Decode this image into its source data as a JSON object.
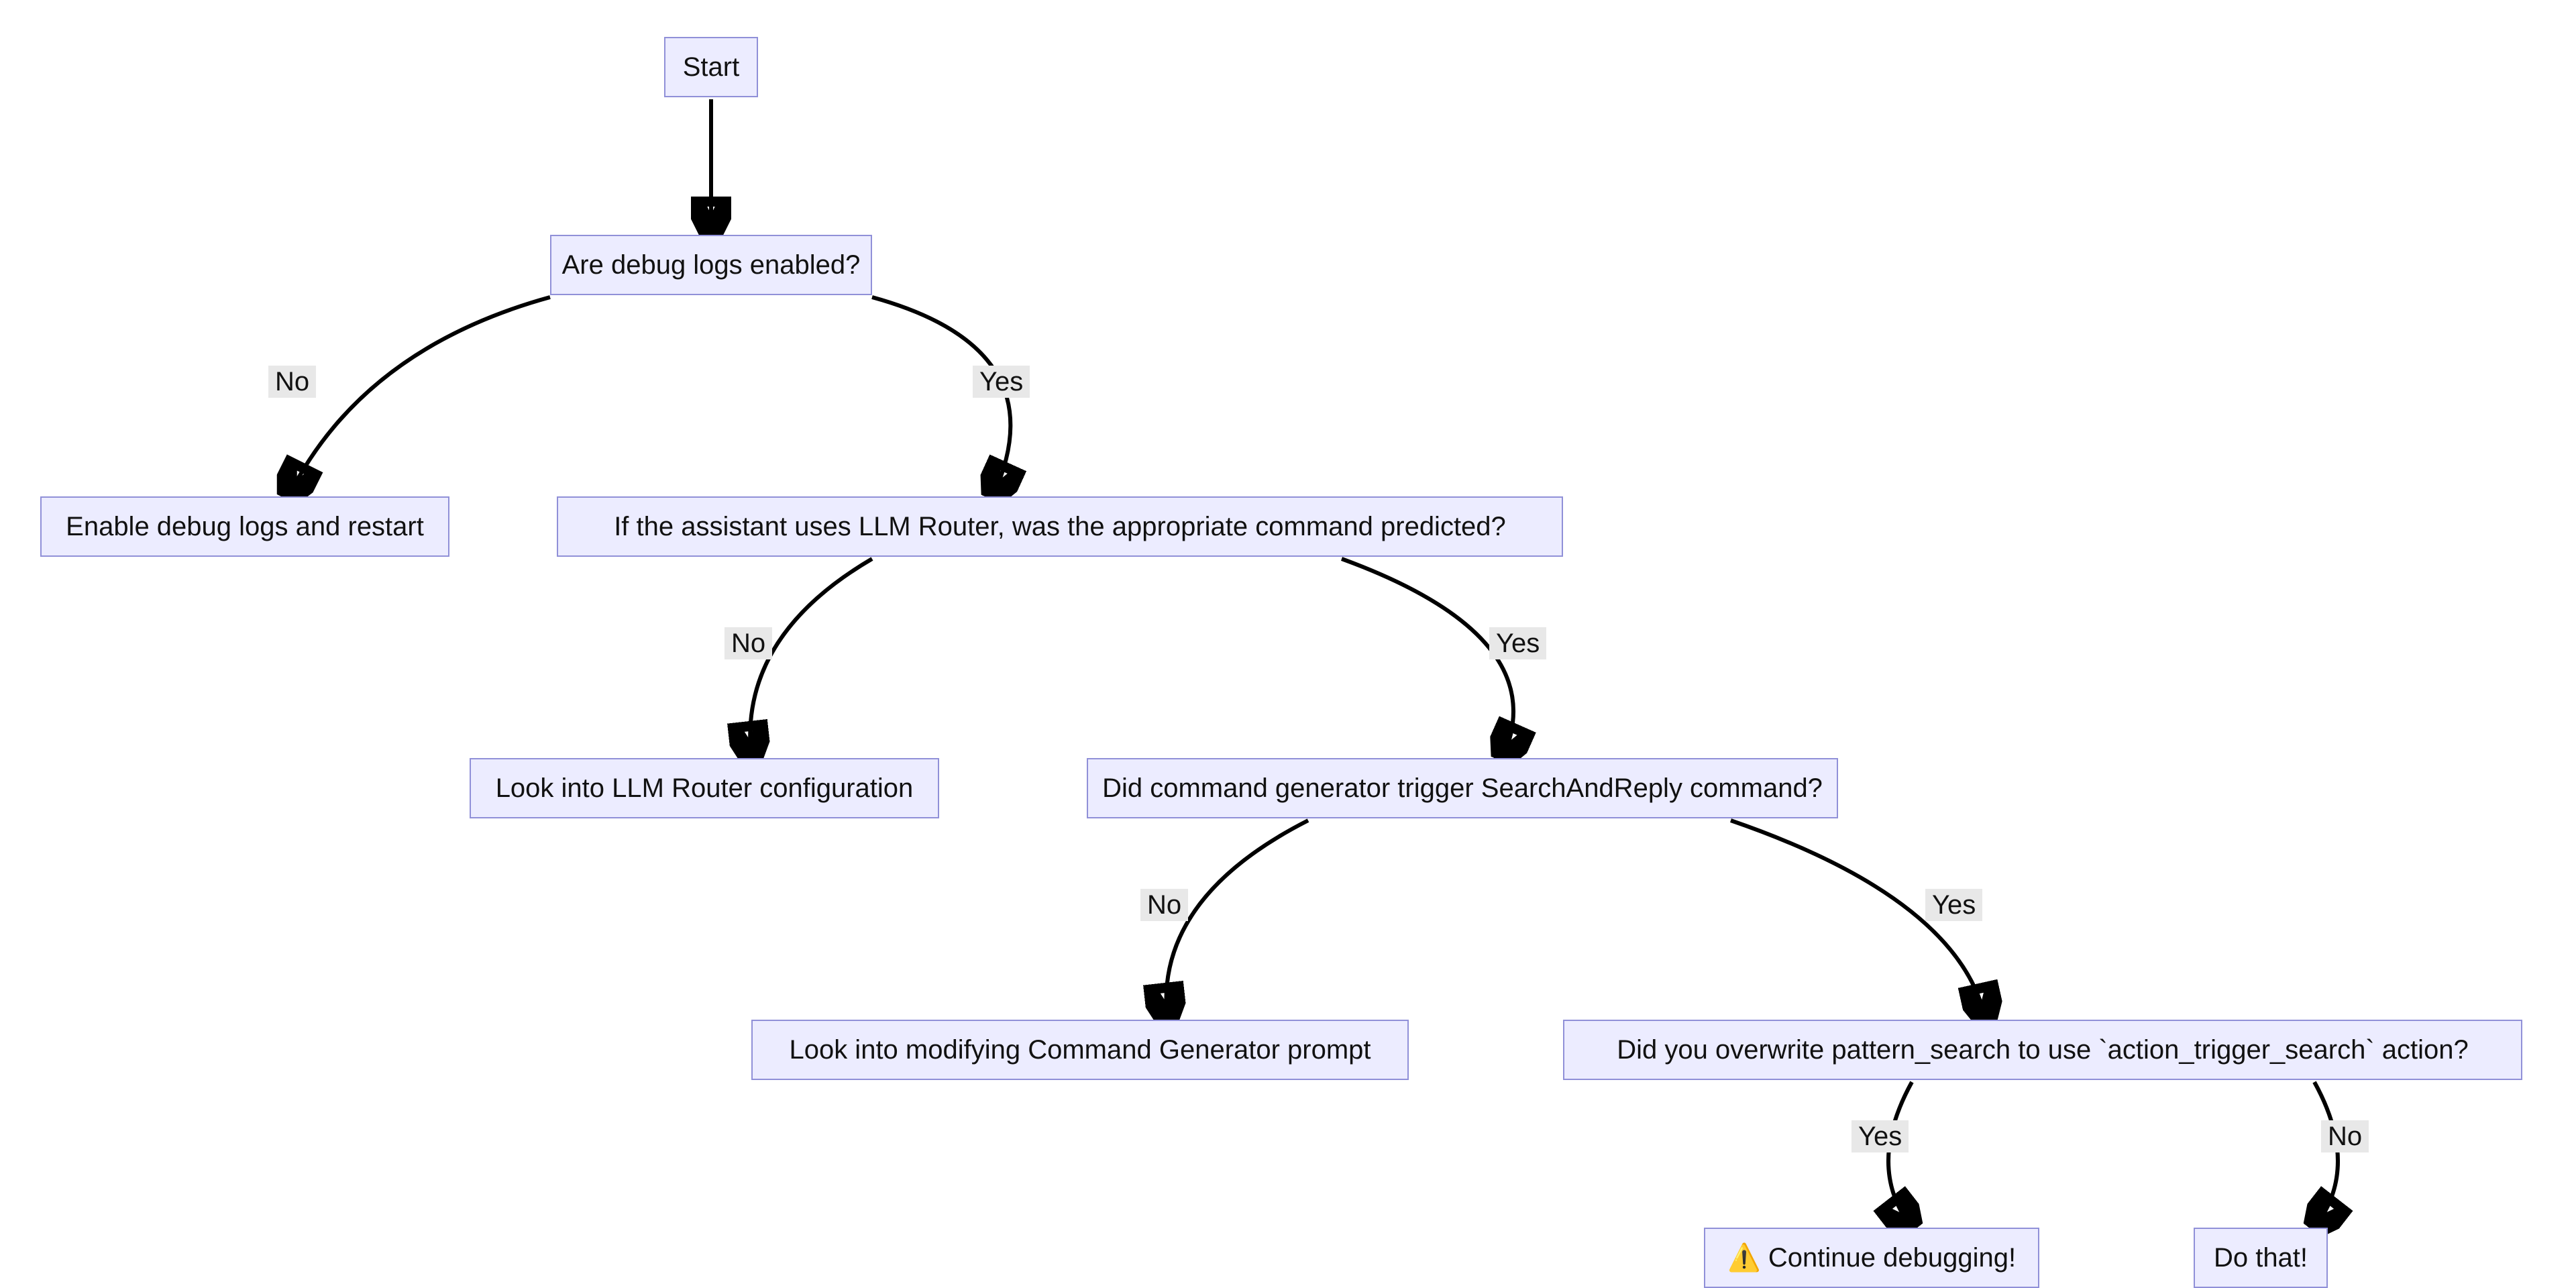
{
  "nodes": {
    "start": "Start",
    "q_debug": "Are debug logs enabled?",
    "a_enable": "Enable debug logs and restart",
    "q_router": "If the assistant uses LLM Router, was the appropriate command predicted?",
    "a_router": "Look into LLM Router configuration",
    "q_cmdgen": "Did command generator trigger SearchAndReply command?",
    "a_cmdgen": "Look into modifying Command Generator prompt",
    "q_pattern": "Did you overwrite pattern_search to use `action_trigger_search` action?",
    "a_continue": "⚠️ Continue debugging!",
    "a_dothat": "Do that!"
  },
  "edges": {
    "no": "No",
    "yes": "Yes"
  },
  "colors": {
    "node_fill": "#ECECFF",
    "node_border": "#9090D8",
    "edge": "#000000",
    "label_bg": "#E8E8E8"
  },
  "chart_data": {
    "type": "flowchart",
    "title": "",
    "nodes": [
      {
        "id": "start",
        "label": "Start"
      },
      {
        "id": "q_debug",
        "label": "Are debug logs enabled?"
      },
      {
        "id": "a_enable",
        "label": "Enable debug logs and restart"
      },
      {
        "id": "q_router",
        "label": "If the assistant uses LLM Router, was the appropriate command predicted?"
      },
      {
        "id": "a_router",
        "label": "Look into LLM Router configuration"
      },
      {
        "id": "q_cmdgen",
        "label": "Did command generator trigger SearchAndReply command?"
      },
      {
        "id": "a_cmdgen",
        "label": "Look into modifying Command Generator prompt"
      },
      {
        "id": "q_pattern",
        "label": "Did you overwrite pattern_search to use `action_trigger_search` action?"
      },
      {
        "id": "a_continue",
        "label": "⚠️ Continue debugging!"
      },
      {
        "id": "a_dothat",
        "label": "Do that!"
      }
    ],
    "edges": [
      {
        "from": "start",
        "to": "q_debug",
        "label": ""
      },
      {
        "from": "q_debug",
        "to": "a_enable",
        "label": "No"
      },
      {
        "from": "q_debug",
        "to": "q_router",
        "label": "Yes"
      },
      {
        "from": "q_router",
        "to": "a_router",
        "label": "No"
      },
      {
        "from": "q_router",
        "to": "q_cmdgen",
        "label": "Yes"
      },
      {
        "from": "q_cmdgen",
        "to": "a_cmdgen",
        "label": "No"
      },
      {
        "from": "q_cmdgen",
        "to": "q_pattern",
        "label": "Yes"
      },
      {
        "from": "q_pattern",
        "to": "a_continue",
        "label": "Yes"
      },
      {
        "from": "q_pattern",
        "to": "a_dothat",
        "label": "No"
      }
    ]
  }
}
